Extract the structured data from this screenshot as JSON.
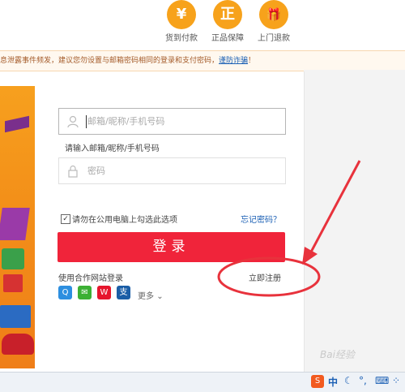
{
  "badges": [
    {
      "glyph": "¥",
      "label": "货到付款",
      "icon": "yuan-coin-icon"
    },
    {
      "glyph": "正",
      "label": "正品保障",
      "icon": "genuine-icon"
    },
    {
      "glyph": "🎁",
      "label": "上门退款",
      "icon": "gift-return-icon"
    }
  ],
  "notice": {
    "text": "息泄露事件频发，建议您勿设置与邮箱密码相同的登录和支付密码，",
    "link": "谨防诈骗",
    "suffix": "！"
  },
  "form": {
    "username_placeholder": "邮箱/昵称/手机号码",
    "username_hint": "请输入邮箱/昵称/手机号码",
    "password_placeholder": "密码",
    "remember_label": "请勿在公用电脑上勾选此选项",
    "remember_checked": true,
    "forgot_label": "忘记密码？",
    "login_label": "登录"
  },
  "partners": {
    "label": "使用合作网站登录",
    "icons": [
      "qq-icon",
      "wechat-icon",
      "weibo-icon",
      "alipay-icon"
    ],
    "more_label": "更多",
    "register_label": "立即注册"
  },
  "taskbar": {
    "ime_label": "中"
  },
  "watermark": "Bai经验",
  "colors": {
    "accent_red": "#f0243a",
    "badge_orange": "#f7a21b",
    "annotation_red": "#e8323c",
    "link_blue": "#1a5fb4"
  }
}
